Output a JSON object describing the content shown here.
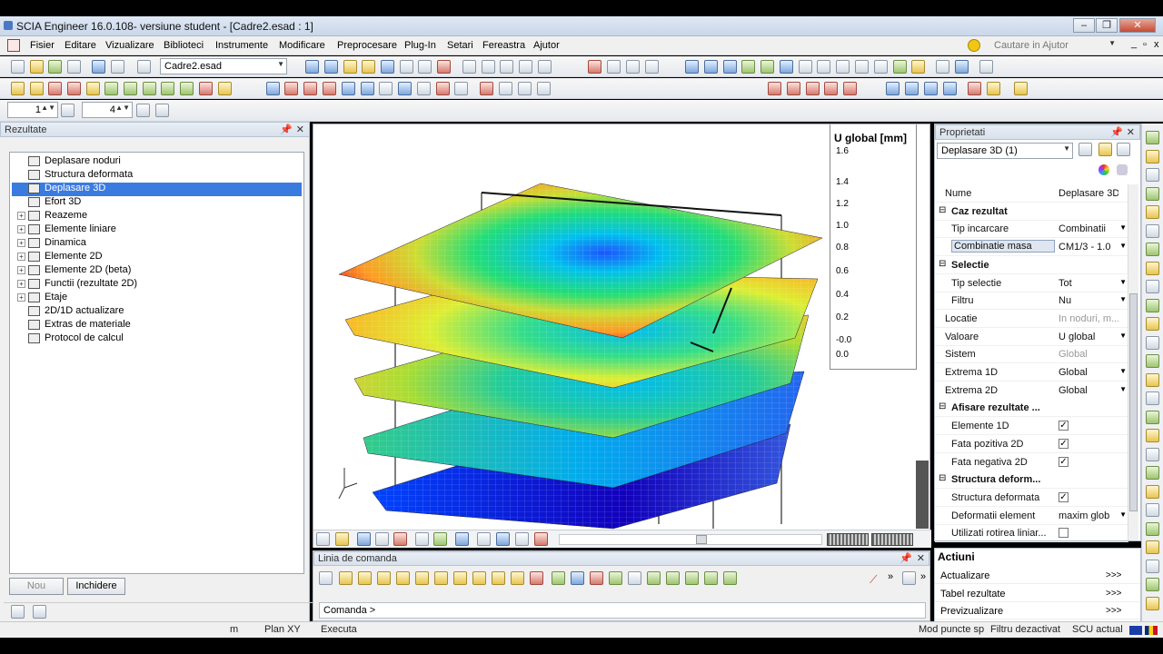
{
  "window": {
    "title": "SCIA Engineer 16.0.108- versiune student - [Cadre2.esad : 1]",
    "minimize": "–",
    "maximize": "❐",
    "close": "✕"
  },
  "menu": [
    "Fisier",
    "Editare",
    "Vizualizare",
    "Biblioteci",
    "Instrumente",
    "Modificare",
    "Preprocesare",
    "Plug-In",
    "Setari",
    "Fereastra",
    "Ajutor"
  ],
  "help_search": {
    "placeholder": "Cautare in Ajutor"
  },
  "toolbar": {
    "project_combo": "Cadre2.esad",
    "spin1": "1",
    "spin2": "4"
  },
  "results_panel": {
    "title": "Rezultate",
    "items": [
      {
        "label": "Deplasare noduri",
        "expandable": false,
        "selected": false
      },
      {
        "label": "Structura deformata",
        "expandable": false,
        "selected": false
      },
      {
        "label": "Deplasare 3D",
        "expandable": false,
        "selected": true
      },
      {
        "label": "Efort 3D",
        "expandable": false,
        "selected": false
      },
      {
        "label": "Reazeme",
        "expandable": true,
        "selected": false
      },
      {
        "label": "Elemente liniare",
        "expandable": true,
        "selected": false
      },
      {
        "label": "Dinamica",
        "expandable": true,
        "selected": false
      },
      {
        "label": "Elemente 2D",
        "expandable": true,
        "selected": false
      },
      {
        "label": "Elemente 2D (beta)",
        "expandable": true,
        "selected": false
      },
      {
        "label": "Functii (rezultate 2D)",
        "expandable": true,
        "selected": false
      },
      {
        "label": "Etaje",
        "expandable": true,
        "selected": false
      },
      {
        "label": "2D/1D actualizare",
        "expandable": false,
        "selected": false
      },
      {
        "label": "Extras de materiale",
        "expandable": false,
        "selected": false
      },
      {
        "label": "Protocol de calcul",
        "expandable": false,
        "selected": false
      }
    ],
    "new_button": "Nou",
    "close_button": "Inchidere"
  },
  "legend": {
    "title": "U global [mm]",
    "ticks": [
      "1.6",
      "1.4",
      "1.2",
      "1.0",
      "0.8",
      "0.6",
      "0.4",
      "0.2",
      "-0.0",
      "0.0"
    ]
  },
  "properties": {
    "title": "Proprietati",
    "selector": "Deplasare 3D (1)",
    "rows": [
      {
        "type": "row",
        "key": "Nume",
        "value": "Deplasare 3D",
        "indent": false
      },
      {
        "type": "group",
        "key": "Caz rezultat"
      },
      {
        "type": "row",
        "key": "Tip incarcare",
        "value": "Combinatii",
        "dropdown": true
      },
      {
        "type": "row",
        "key": "Combinatie masa",
        "value": "CM1/3 - 1.0",
        "dropdown": true,
        "highlight": true
      },
      {
        "type": "group",
        "key": "Selectie"
      },
      {
        "type": "row",
        "key": "Tip selectie",
        "value": "Tot",
        "dropdown": true
      },
      {
        "type": "row",
        "key": "Filtru",
        "value": "Nu",
        "dropdown": true
      },
      {
        "type": "row",
        "key": "Locatie",
        "value": "In noduri, m...",
        "gray": true
      },
      {
        "type": "row",
        "key": "Valoare",
        "value": "U global",
        "dropdown": true
      },
      {
        "type": "row",
        "key": "Sistem",
        "value": "Global",
        "gray": true
      },
      {
        "type": "row",
        "key": "Extrema 1D",
        "value": "Global",
        "dropdown": true
      },
      {
        "type": "row",
        "key": "Extrema 2D",
        "value": "Global",
        "dropdown": true
      },
      {
        "type": "group",
        "key": "Afisare rezultate ..."
      },
      {
        "type": "check",
        "key": "Elemente 1D",
        "checked": true
      },
      {
        "type": "check",
        "key": "Fata pozitiva 2D",
        "checked": true
      },
      {
        "type": "check",
        "key": "Fata negativa 2D",
        "checked": true
      },
      {
        "type": "group",
        "key": "Structura deform..."
      },
      {
        "type": "check",
        "key": "Structura deformata",
        "checked": true
      },
      {
        "type": "row",
        "key": "Deformatii element",
        "value": "maxim glob",
        "dropdown": true
      },
      {
        "type": "check",
        "key": "Utilizati rotirea liniar...",
        "checked": false
      }
    ]
  },
  "command_panel": {
    "title": "Linia de comanda",
    "prompt": "Comanda >"
  },
  "actions": {
    "title": "Actiuni",
    "items": [
      {
        "label": "Actualizare",
        "arrow": ">>>"
      },
      {
        "label": "Tabel rezultate",
        "arrow": ">>>"
      },
      {
        "label": "Previzualizare",
        "arrow": ">>>"
      }
    ]
  },
  "status": {
    "unit": "m",
    "plane": "Plan XY",
    "mode": "Executa",
    "snap": "Mod puncte sp",
    "filter": "Filtru dezactivat",
    "ucs": "SCU actual"
  },
  "colors": {
    "selection": "#3a7be0",
    "legend_gradient": [
      "#2200aa",
      "#0055ff",
      "#00bbee",
      "#00dd88",
      "#66dd33",
      "#ddee22",
      "#ffbb00",
      "#ff6600",
      "#dd1111"
    ]
  }
}
